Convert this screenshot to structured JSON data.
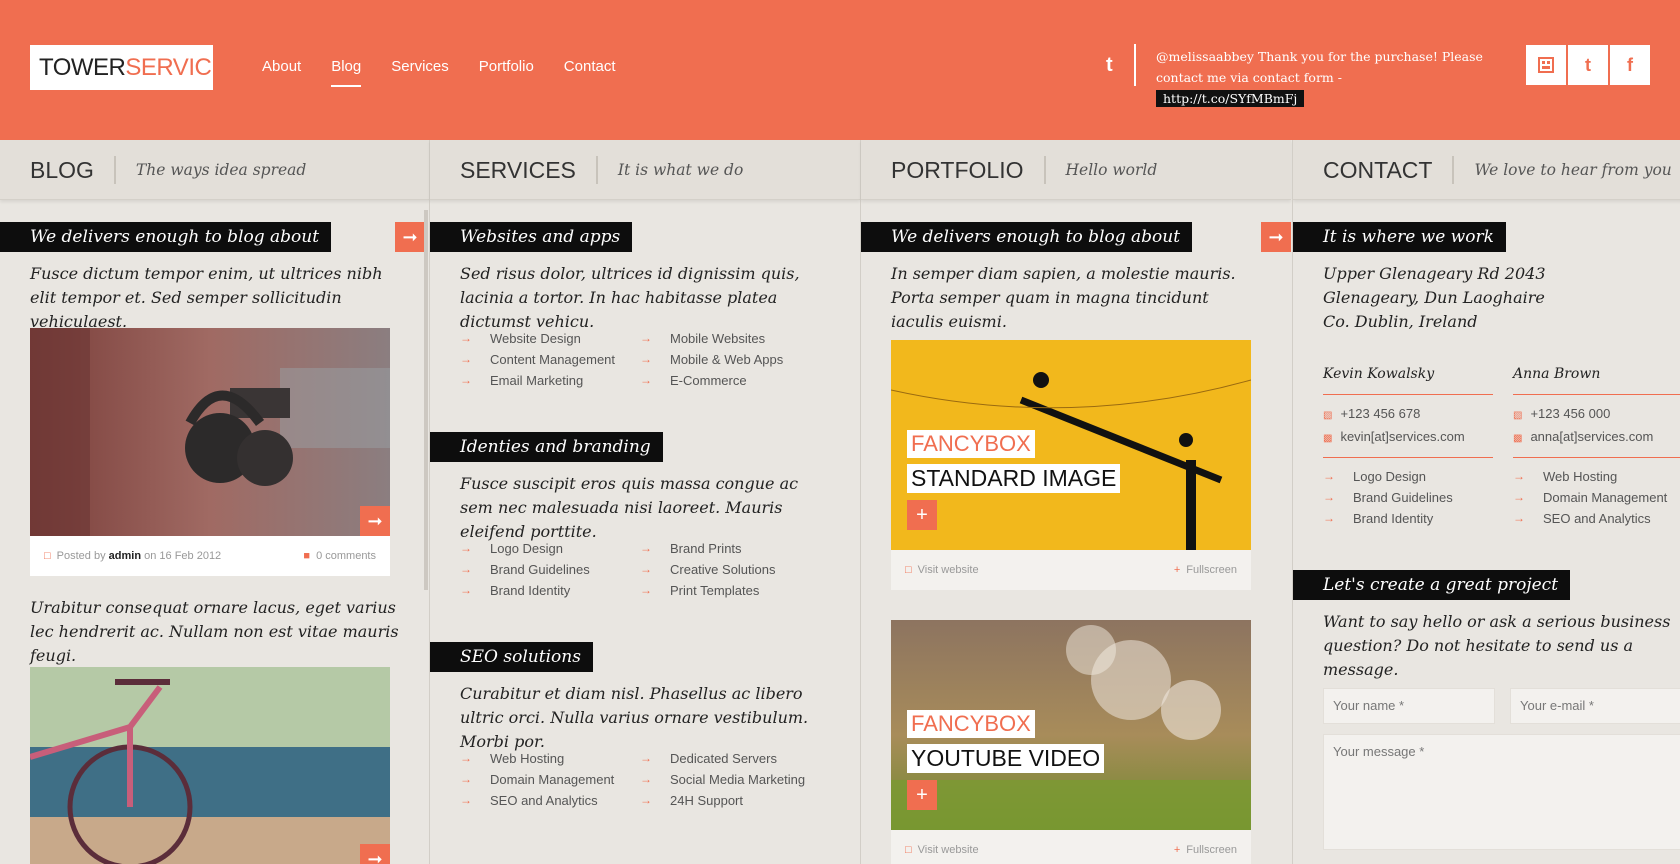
{
  "header": {
    "logo_a": "TOWER",
    "logo_b": "SERVICES",
    "nav": [
      "About",
      "Blog",
      "Services",
      "Portfolio",
      "Contact"
    ],
    "active_nav": "Blog",
    "tweet_text": "@melissaabbey Thank you for the purchase! Please contact me via contact form - ",
    "tweet_link": "http://t.co/SYfMBmFj",
    "social": [
      "rss-icon",
      "twitter-icon",
      "facebook-icon"
    ]
  },
  "blog": {
    "title": "BLOG",
    "tagline": "The ways idea spread",
    "label": "We delivers enough to blog about",
    "post1_intro": "Fusce dictum tempor enim, ut ultrices nibh elit tempor et. Sed semper sollicitudin vehiculaest.",
    "posted_by": "Posted by",
    "author": "admin",
    "on_date": "on 16 Feb 2012",
    "comments": "0 comments",
    "post2_intro": "Urabitur consequat ornare lacus, eget varius lec hendrerit ac. Nullam non est vitae mauris feugi."
  },
  "services": {
    "title": "SERVICES",
    "tagline": "It is what we do",
    "sections": [
      {
        "label": "Websites and apps",
        "intro": "Sed risus dolor, ultrices id dignissim quis, lacinia a tortor. In hac habitasse platea dictumst vehicu.",
        "left": [
          "Website Design",
          "Content Management",
          "Email Marketing"
        ],
        "right": [
          "Mobile Websites",
          "Mobile & Web Apps",
          "E-Commerce"
        ]
      },
      {
        "label": "Identies and branding",
        "intro": "Fusce suscipit eros quis massa congue ac sem nec malesuada nisi laoreet. Mauris eleifend porttite.",
        "left": [
          "Logo Design",
          "Brand Guidelines",
          "Brand Identity"
        ],
        "right": [
          "Brand Prints",
          "Creative Solutions",
          "Print Templates"
        ]
      },
      {
        "label": "SEO solutions",
        "intro": "Curabitur et diam nisl. Phasellus ac libero ultric orci. Nulla varius ornare vestibulum. Morbi por.",
        "left": [
          "Web Hosting",
          "Domain Management",
          "SEO and Analytics"
        ],
        "right": [
          "Dedicated Servers",
          "Social Media Marketing",
          "24H Support"
        ]
      }
    ]
  },
  "portfolio": {
    "title": "PORTFOLIO",
    "tagline": "Hello world",
    "label": "We delivers enough to blog about",
    "intro": "In semper diam sapien, a molestie mauris. Porta semper quam in magna tincidunt iaculis euismi.",
    "items": [
      {
        "cap1": "FANCYBOX",
        "cap2": "STANDARD IMAGE",
        "visit": "Visit website",
        "full": "Fullscreen"
      },
      {
        "cap1": "FANCYBOX",
        "cap2": "YOUTUBE VIDEO",
        "visit": "Visit website",
        "full": "Fullscreen"
      }
    ]
  },
  "contact": {
    "title": "CONTACT",
    "tagline": "We love to hear from you",
    "label": "It is where we work",
    "address": [
      "Upper Glenageary Rd 2043",
      "Glenageary, Dun Laoghaire",
      "Co. Dublin, Ireland"
    ],
    "people": [
      {
        "name": "Kevin Kowalsky",
        "phone": "+123 456 678",
        "email": "kevin[at]services.com",
        "list": [
          "Logo Design",
          "Brand Guidelines",
          "Brand Identity"
        ]
      },
      {
        "name": "Anna Brown",
        "phone": "+123 456 000",
        "email": "anna[at]services.com",
        "list": [
          "Web Hosting",
          "Domain Management",
          "SEO and Analytics"
        ]
      }
    ],
    "form_label": "Let's create a great project",
    "form_intro": "Want to say hello or ask a serious business question? Do not hesitate to send us a message.",
    "name_placeholder": "Your name *",
    "email_placeholder": "Your e-mail *",
    "message_placeholder": "Your message *"
  },
  "colors": {
    "accent": "#f06e50",
    "dark": "#0d0d0d",
    "bg": "#e9e6e1"
  }
}
